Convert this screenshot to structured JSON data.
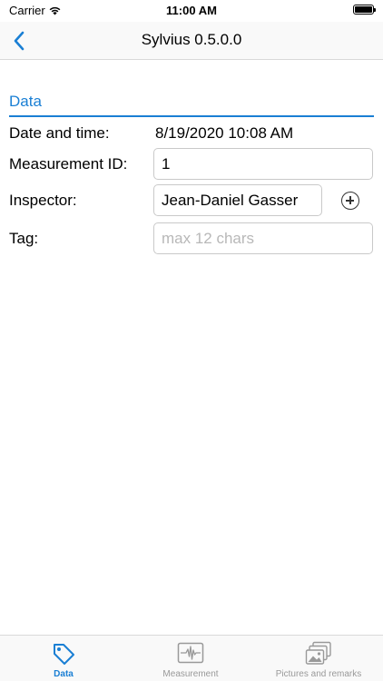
{
  "status_bar": {
    "carrier": "Carrier",
    "time": "11:00 AM",
    "battery_level": 1.0
  },
  "nav": {
    "title": "Sylvius 0.5.0.0",
    "back_icon": "chevron-left-icon"
  },
  "section": {
    "title": "Data"
  },
  "form": {
    "date_label": "Date and time:",
    "date_value": "8/19/2020 10:08 AM",
    "measurement_label": "Measurement ID:",
    "measurement_value": "1",
    "inspector_label": "Inspector:",
    "inspector_value": "Jean-Daniel Gasser",
    "tag_label": "Tag:",
    "tag_placeholder": "max 12 chars",
    "tag_value": ""
  },
  "tabs": [
    {
      "label": "Data",
      "icon": "tag-icon",
      "active": true
    },
    {
      "label": "Measurement",
      "icon": "waveform-icon",
      "active": false
    },
    {
      "label": "Pictures and remarks",
      "icon": "photos-icon",
      "active": false
    }
  ],
  "colors": {
    "accent": "#1a7fd4",
    "inactive": "#999999"
  }
}
